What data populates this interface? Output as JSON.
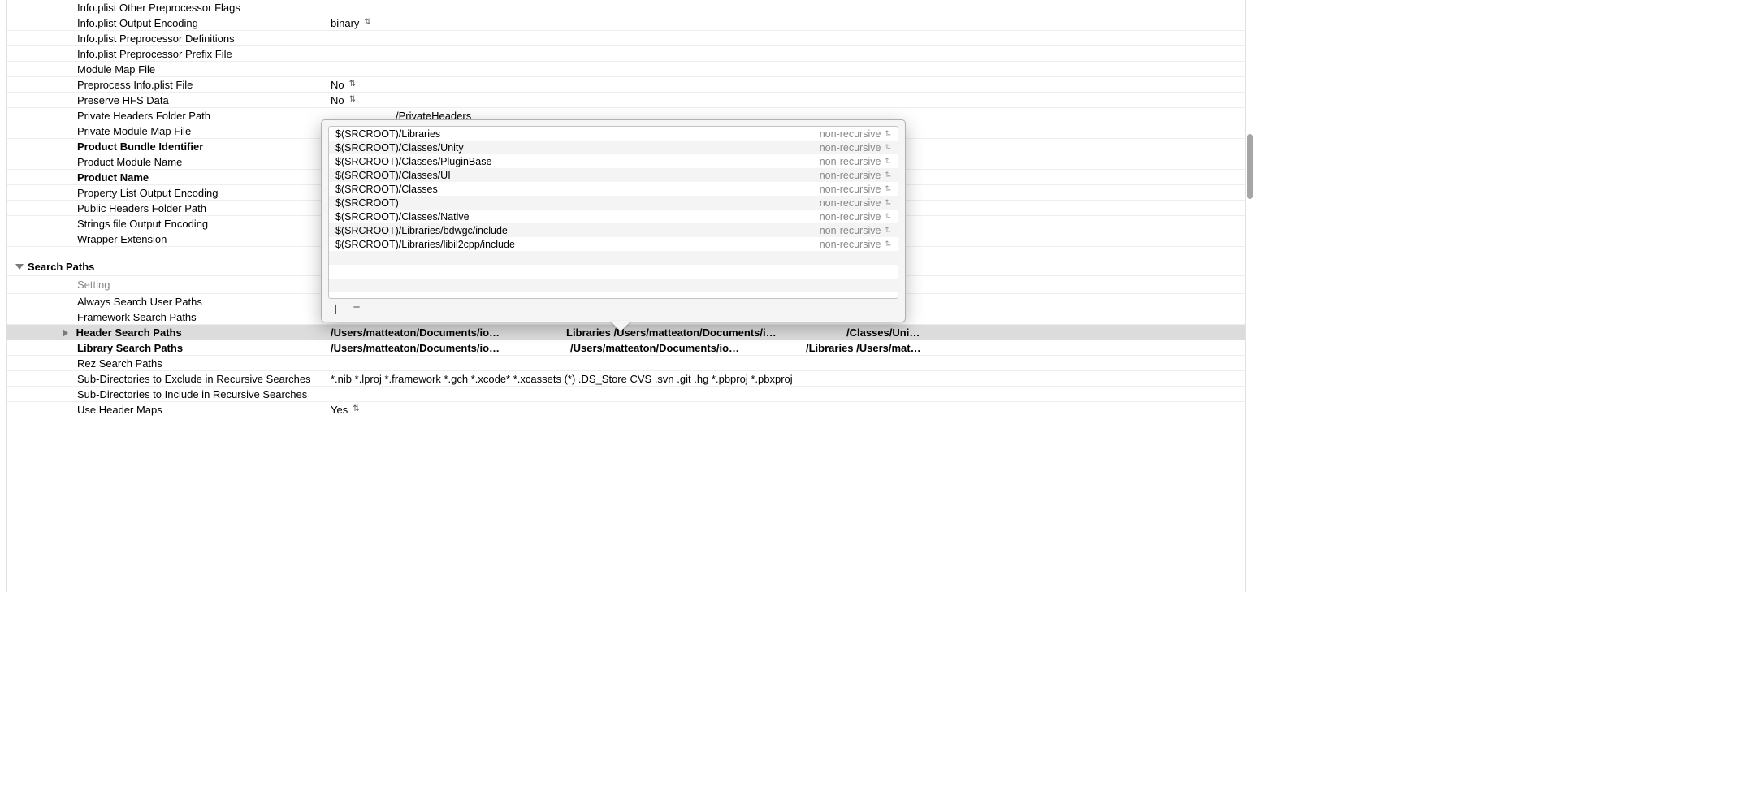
{
  "settings": [
    {
      "label": "Info.plist Other Preprocessor Flags",
      "value": ""
    },
    {
      "label": "Info.plist Output Encoding",
      "value": "binary",
      "dropdown": true
    },
    {
      "label": "Info.plist Preprocessor Definitions",
      "value": ""
    },
    {
      "label": "Info.plist Preprocessor Prefix File",
      "value": ""
    },
    {
      "label": "Module Map File",
      "value": ""
    },
    {
      "label": "Preprocess Info.plist File",
      "value": "No",
      "dropdown": true
    },
    {
      "label": "Preserve HFS Data",
      "value": "No",
      "dropdown": true
    },
    {
      "label": "Private Headers Folder Path",
      "value_indent": "/PrivateHeaders"
    },
    {
      "label": "Private Module Map File",
      "value": ""
    },
    {
      "label": "Product Bundle Identifier",
      "bold": true,
      "value": ""
    },
    {
      "label": "Product Module Name",
      "value": ""
    },
    {
      "label": "Product Name",
      "bold": true,
      "value": ""
    },
    {
      "label": "Property List Output Encoding",
      "value": ""
    },
    {
      "label": "Public Headers Folder Path",
      "value": ""
    },
    {
      "label": "Strings file Output Encoding",
      "value": ""
    },
    {
      "label": "Wrapper Extension",
      "value": ""
    }
  ],
  "section": {
    "title": "Search Paths",
    "column_label": "Setting"
  },
  "search_settings": [
    {
      "label": "Always Search User Paths",
      "value": ""
    },
    {
      "label": "Framework Search Paths",
      "value": ""
    },
    {
      "label": "Header Search Paths",
      "bold": true,
      "selected": true,
      "expandable": true,
      "seg1": "/Users/matteaton/Documents/iosdev/",
      "seg2": "Libraries /Users/matteaton/Documents/iosdev",
      "seg3": "/Classes/Uni…"
    },
    {
      "label": "Library Search Paths",
      "bold": true,
      "seg1": "/Users/matteaton/Documents/iosdev/",
      "seg2": "/Users/matteaton/Documents/iosdev/",
      "seg3": "/Libraries /Users/mat…"
    },
    {
      "label": "Rez Search Paths",
      "value": ""
    },
    {
      "label": "Sub-Directories to Exclude in Recursive Searches",
      "value": "*.nib *.lproj *.framework *.gch *.xcode* *.xcassets (*) .DS_Store CVS .svn .git .hg *.pbproj *.pbxproj"
    },
    {
      "label": "Sub-Directories to Include in Recursive Searches",
      "value": ""
    },
    {
      "label": "Use Header Maps",
      "value": "Yes",
      "dropdown": true
    }
  ],
  "popover": {
    "entries": [
      {
        "path": "$(SRCROOT)/Libraries",
        "recursive": "non-recursive"
      },
      {
        "path": "$(SRCROOT)/Classes/Unity",
        "recursive": "non-recursive"
      },
      {
        "path": "$(SRCROOT)/Classes/PluginBase",
        "recursive": "non-recursive"
      },
      {
        "path": "$(SRCROOT)/Classes/UI",
        "recursive": "non-recursive"
      },
      {
        "path": "$(SRCROOT)/Classes",
        "recursive": "non-recursive"
      },
      {
        "path": "$(SRCROOT)",
        "recursive": "non-recursive"
      },
      {
        "path": "$(SRCROOT)/Classes/Native",
        "recursive": "non-recursive"
      },
      {
        "path": "$(SRCROOT)/Libraries/bdwgc/include",
        "recursive": "non-recursive"
      },
      {
        "path": "$(SRCROOT)/Libraries/libil2cpp/include",
        "recursive": "non-recursive"
      }
    ],
    "add_label": "＋",
    "remove_label": "−"
  }
}
